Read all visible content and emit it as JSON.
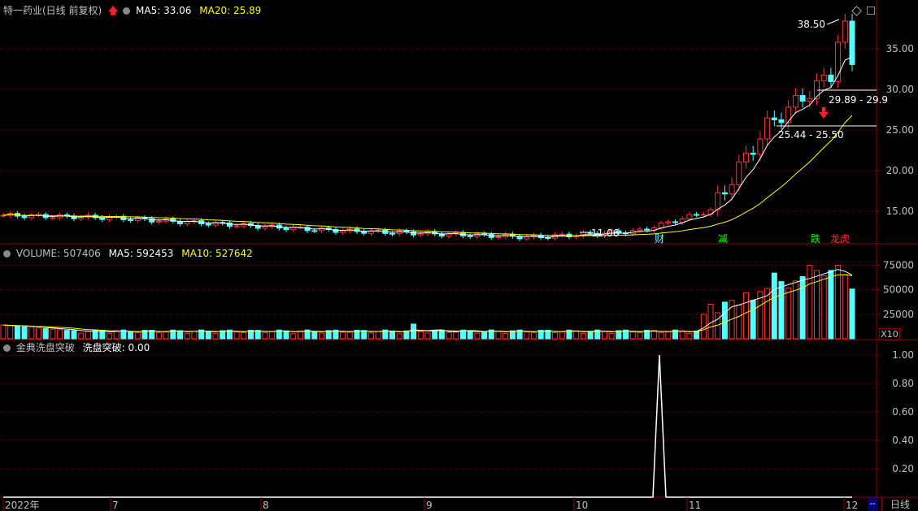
{
  "header": {
    "title": "特一药业(日线 前复权)",
    "ma5_label": "MA5: 33.06",
    "ma20_label": "MA20: 25.89",
    "volume_label": "VOLUME: 507406",
    "vol_ma5_label": "MA5: 592453",
    "vol_ma10_label": "MA10: 527642",
    "indicator_label": "金典洗盘突破",
    "indicator_value_label": "洗盘突破: 0.00",
    "period_label": "日线",
    "x10_label": "X10"
  },
  "colors": {
    "up": "#ff3232",
    "down": "#54ffff",
    "ma_white": "#ffffff",
    "ma_yellow": "#ffff00",
    "grid": "#8b0000",
    "axis_text": "#c0c0c0"
  },
  "chart_data": [
    {
      "type": "candlestick",
      "title": "特一药业(日线 前复权)",
      "ylim": [
        11,
        39
      ],
      "y_ticks": [
        15.0,
        20.0,
        25.0,
        30.0,
        35.0
      ],
      "y_tick_labels": [
        "15.00",
        "20.00",
        "25.00",
        "30.00",
        "35.00"
      ],
      "x_tick_labels": [
        "2022年",
        "7",
        "8",
        "9",
        "10",
        "11",
        "12"
      ],
      "annotations": {
        "high_label": "38.50",
        "low_label": "11.06",
        "zone_upper_label": "29.89 - 29.9",
        "zone_lower_label": "25.44 - 25.50",
        "zone_upper": 29.9,
        "zone_lower": 25.5,
        "markers": [
          {
            "text": "财",
            "color": "#54ffff"
          },
          {
            "text": "减",
            "color": "#00ff00"
          },
          {
            "text": "跌",
            "color": "#00ff00"
          },
          {
            "text": "龙虎",
            "color": "#ff3232"
          }
        ]
      },
      "series": [
        {
          "name": "MA5"
        },
        {
          "name": "MA20"
        }
      ]
    },
    {
      "type": "bar",
      "title": "VOLUME",
      "ylim": [
        0,
        82000
      ],
      "y_ticks": [
        25000,
        50000,
        75000
      ],
      "y_tick_labels": [
        "25000",
        "50000",
        "75000"
      ],
      "peaks": [
        {
          "date": "2022-11-08",
          "value": 67000
        },
        {
          "date": "2022-11-14",
          "value": 75000
        },
        {
          "date": "2022-12-01",
          "value": 75000
        }
      ],
      "last_value": 50740,
      "series": [
        {
          "name": "MA5"
        },
        {
          "name": "MA10"
        }
      ]
    },
    {
      "type": "line",
      "title": "金典洗盘突破",
      "ylim": [
        0,
        1.0
      ],
      "y_ticks": [
        0.2,
        0.4,
        0.6,
        0.8,
        1.0
      ],
      "y_tick_labels": [
        "0.20",
        "0.40",
        "0.60",
        "0.80",
        "1.00"
      ],
      "spikes": [
        {
          "date": "2022-10-27",
          "value": 1.0
        }
      ],
      "last_value": 0.0
    }
  ]
}
